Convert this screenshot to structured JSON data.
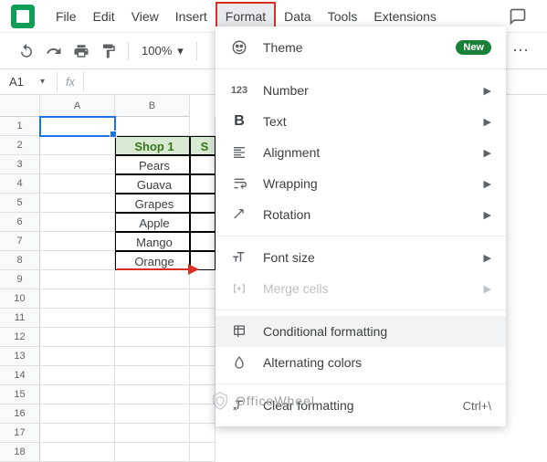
{
  "menubar": {
    "items": [
      "File",
      "Edit",
      "View",
      "Insert",
      "Format",
      "Data",
      "Tools",
      "Extensions"
    ],
    "active_index": 4
  },
  "toolbar": {
    "zoom": "100%"
  },
  "namebox": {
    "ref": "A1",
    "fx": "fx"
  },
  "columns": [
    "A",
    "B"
  ],
  "row_count": 18,
  "sheet": {
    "header_row": 2,
    "header_col": "B",
    "header_label": "Shop 1",
    "header_label_cut": "S",
    "data": [
      "Pears",
      "Guava",
      "Grapes",
      "Apple",
      "Mango",
      "Orange"
    ]
  },
  "dropdown": {
    "theme": "Theme",
    "new_badge": "New",
    "number": "Number",
    "text": "Text",
    "alignment": "Alignment",
    "wrapping": "Wrapping",
    "rotation": "Rotation",
    "fontsize": "Font size",
    "merge": "Merge cells",
    "conditional": "Conditional formatting",
    "alternating": "Alternating colors",
    "clear": "Clear formatting",
    "clear_shortcut": "Ctrl+\\"
  },
  "watermark": "OfficeWheel"
}
